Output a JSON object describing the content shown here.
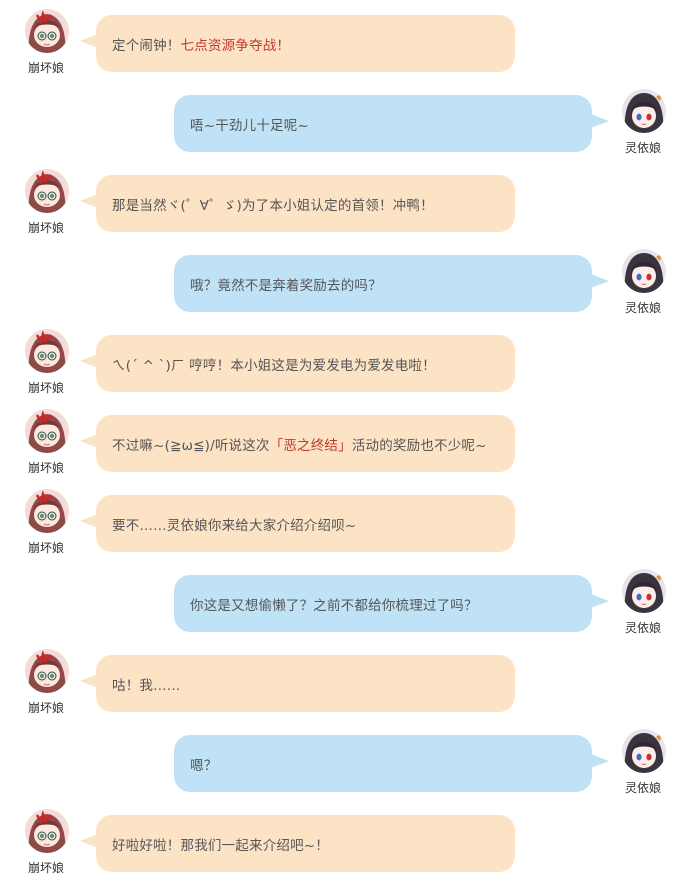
{
  "speakers": {
    "beng": {
      "name": "崩坏娘"
    },
    "ling": {
      "name": "灵依娘"
    }
  },
  "colors": {
    "left_bubble": "#fde3c6",
    "right_bubble": "#bfe2f6",
    "highlight": "#c0392b",
    "text": "#555555"
  },
  "messages": [
    {
      "speaker_name": "崩坏娘",
      "pre": "定个闹钟！",
      "highlight": "七点资源争夺战！",
      "post": ""
    },
    {
      "speaker_name": "灵依娘",
      "text": "唔~干劲儿十足呢~"
    },
    {
      "speaker_name": "崩坏娘",
      "text": "那是当然ヾ(゜∀゜ゞ)为了本小姐认定的首领！冲鸭！"
    },
    {
      "speaker_name": "灵依娘",
      "text": "哦？竟然不是奔着奖励去的吗？"
    },
    {
      "speaker_name": "崩坏娘",
      "text": "ㄟ(ˊ ^ ˋ)ㄏ 哼哼！本小姐这是为爱发电为爱发电啦！"
    },
    {
      "speaker_name": "崩坏娘",
      "pre": "不过嘛~(≧ω≦)/听说这次",
      "highlight": "「恶之终结」",
      "post": "活动的奖励也不少呢~"
    },
    {
      "speaker_name": "崩坏娘",
      "text": "要不……灵依娘你来给大家介绍介绍呗~"
    },
    {
      "speaker_name": "灵依娘",
      "text": "你这是又想偷懒了？之前不都给你梳理过了吗？"
    },
    {
      "speaker_name": "崩坏娘",
      "text": "咕！我……"
    },
    {
      "speaker_name": "灵依娘",
      "text": "嗯？"
    },
    {
      "speaker_name": "崩坏娘",
      "text": "好啦好啦！那我们一起来介绍吧~！"
    }
  ]
}
